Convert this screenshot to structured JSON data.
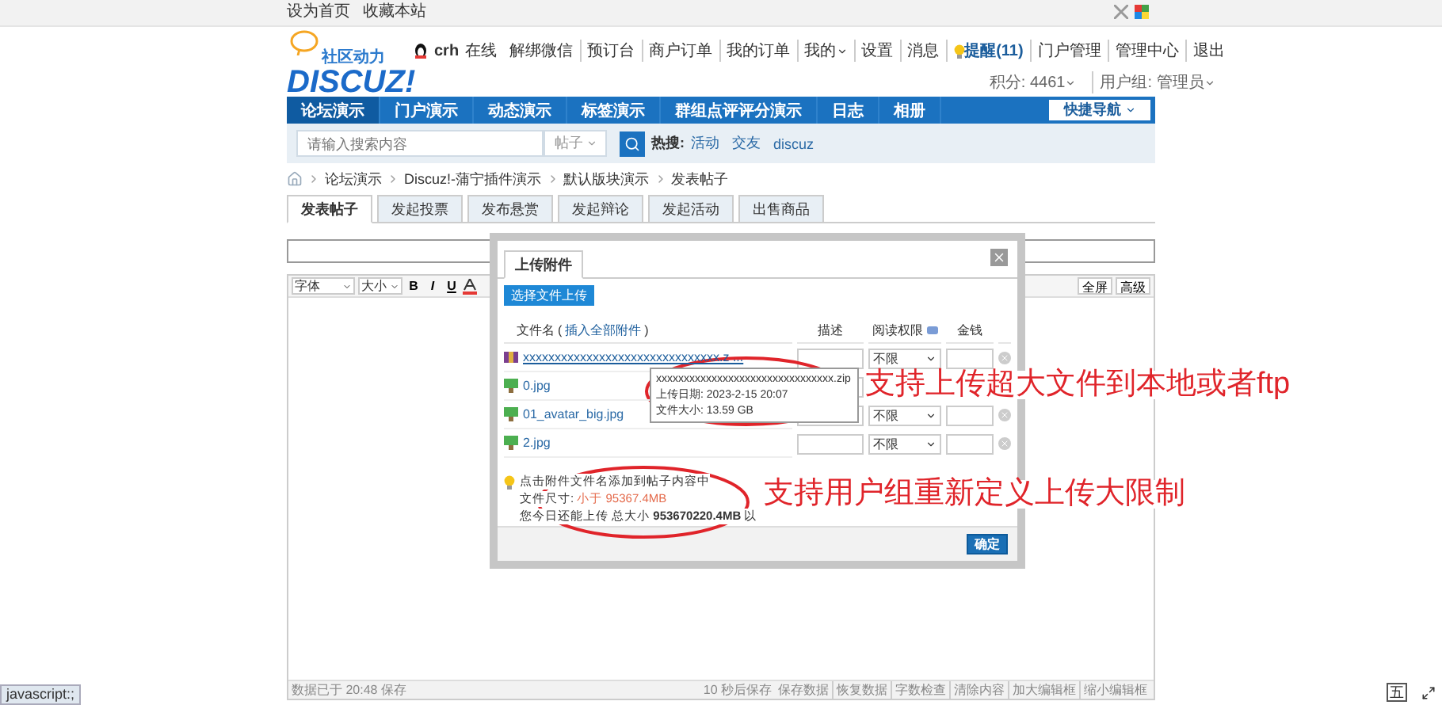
{
  "top_bar": {
    "links": [
      "设为首页",
      "收藏本站"
    ]
  },
  "header": {
    "logo": {
      "tagline": "社区动力",
      "name": "DISCUZ!"
    },
    "user": {
      "name": "crh",
      "status": "在线"
    },
    "user_links": [
      {
        "label": "解绑微信",
        "kind": "link"
      },
      {
        "label": "预订台",
        "kind": "link"
      },
      {
        "label": "商户订单",
        "kind": "link"
      },
      {
        "label": "我的订单",
        "kind": "link"
      },
      {
        "label": "我的",
        "kind": "dropdown"
      },
      {
        "label": "设置",
        "kind": "link"
      },
      {
        "label": "消息",
        "kind": "link"
      },
      {
        "label": "提醒(11)",
        "kind": "alert"
      },
      {
        "label": "门户管理",
        "kind": "link"
      },
      {
        "label": "管理中心",
        "kind": "link"
      },
      {
        "label": "退出",
        "kind": "link"
      }
    ],
    "stats": [
      "积分: 4461",
      "用户组: 管理员"
    ]
  },
  "nav": {
    "items": [
      {
        "label": "论坛演示",
        "selected": true
      },
      {
        "label": "门户演示",
        "selected": false
      },
      {
        "label": "动态演示",
        "selected": false
      },
      {
        "label": "标签演示",
        "selected": false
      },
      {
        "label": "群组点评评分演示",
        "selected": false
      },
      {
        "label": "日志",
        "selected": false
      },
      {
        "label": "相册",
        "selected": false
      }
    ],
    "quick_nav": "快捷导航"
  },
  "search": {
    "placeholder": "请输入搜索内容",
    "scope": "帖子",
    "hot_label": "热搜:",
    "hot": [
      "活动",
      "交友",
      "discuz"
    ]
  },
  "breadcrumb": [
    "论坛演示",
    "Discuz!-蒲宁插件演示",
    "默认版块演示",
    "发表帖子"
  ],
  "post_tabs": [
    {
      "label": "发表帖子",
      "selected": true
    },
    {
      "label": "发起投票",
      "selected": false
    },
    {
      "label": "发布悬赏",
      "selected": false
    },
    {
      "label": "发起辩论",
      "selected": false
    },
    {
      "label": "发起活动",
      "selected": false
    },
    {
      "label": "出售商品",
      "selected": false
    }
  ],
  "editor": {
    "font": "字体",
    "size": "大小",
    "format_buttons": [
      "B",
      "I",
      "U"
    ],
    "right_buttons": [
      "全屏",
      "高级"
    ],
    "status_left": "数据已于 20:48 保存",
    "status_right": [
      "10 秒后保存",
      "保存数据",
      "恢复数据",
      "字数检查",
      "清除内容",
      "加大编辑框",
      "缩小编辑框"
    ]
  },
  "dialog": {
    "title": "上传附件",
    "upload_button": "选择文件上传",
    "columns": {
      "filename": "文件名",
      "brackets": [
        "(",
        ")"
      ],
      "insert_all": "插入全部附件",
      "description": "描述",
      "permission": "阅读权限",
      "money": "金钱"
    },
    "files": [
      {
        "name": "xxxxxxxxxxxxxxxxxxxxxxxxxxxxxxx.z ...",
        "kind": "archive",
        "permission": "不限"
      },
      {
        "name": "0.jpg",
        "kind": "image"
      },
      {
        "name": "01_avatar_big.jpg",
        "kind": "image",
        "permission": "不限"
      },
      {
        "name": "2.jpg",
        "kind": "image",
        "permission": "不限"
      }
    ],
    "tooltip": {
      "name": "xxxxxxxxxxxxxxxxxxxxxxxxxxxxxxxx.zip",
      "date": "上传日期: 2023-2-15 20:07",
      "size": "文件大小: 13.59 GB"
    },
    "notes": {
      "hint": "点击附件文件名添加到帖子内容中",
      "size_label": "文件尺寸: ",
      "size_limit": "小于 95367.4MB",
      "quota": "您今日还能上传 总大小 **953670220.4MB** 以"
    },
    "confirm": "确定"
  },
  "annotations": [
    "支持上传超大文件到本地或者ftp",
    "支持用户组重新定义上传大限制"
  ],
  "status_bubble": "javascript:;",
  "ime_indicator": "五"
}
